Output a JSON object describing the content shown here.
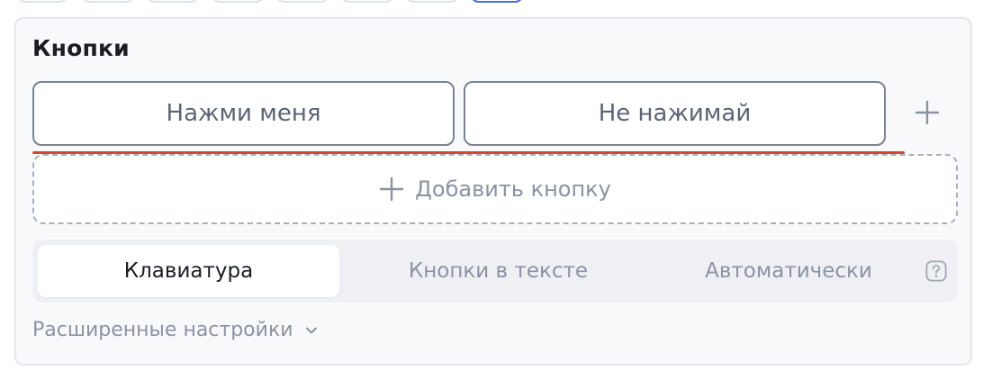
{
  "section": {
    "title": "Кнопки"
  },
  "buttons": [
    {
      "label": "Нажми меня"
    },
    {
      "label": "Не нажимай"
    }
  ],
  "add_button": {
    "label": "Добавить кнопку",
    "icon": "plus-icon"
  },
  "keyboard_modes": {
    "options": [
      "Клавиатура",
      "Кнопки в тексте",
      "Автоматически"
    ],
    "selected": "Клавиатура",
    "help_icon": "question-icon"
  },
  "advanced": {
    "label": "Расширенные настройки",
    "icon": "chevron-down-icon"
  },
  "colors": {
    "error": "#d04a30",
    "active_tab_border": "#4a6cd6",
    "muted_text": "#8b92a3"
  }
}
